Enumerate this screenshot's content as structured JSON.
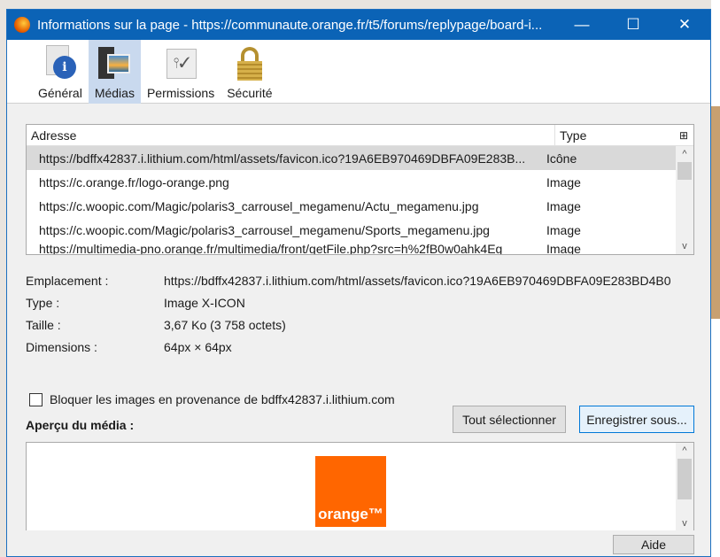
{
  "window": {
    "title": "Informations sur la page - https://communaute.orange.fr/t5/forums/replypage/board-i...",
    "minimize": "—",
    "maximize": "☐",
    "close": "✕"
  },
  "tabs": [
    {
      "label": "Général"
    },
    {
      "label": "Médias"
    },
    {
      "label": "Permissions"
    },
    {
      "label": "Sécurité"
    }
  ],
  "list": {
    "col_address": "Adresse",
    "col_type": "Type",
    "picker": "⊞",
    "rows": [
      {
        "address": "https://bdffx42837.i.lithium.com/html/assets/favicon.ico?19A6EB970469DBFA09E283B...",
        "type": "Icône"
      },
      {
        "address": "https://c.orange.fr/logo-orange.png",
        "type": "Image"
      },
      {
        "address": "https://c.woopic.com/Magic/polaris3_carrousel_megamenu/Actu_megamenu.jpg",
        "type": "Image"
      },
      {
        "address": "https://c.woopic.com/Magic/polaris3_carrousel_megamenu/Sports_megamenu.jpg",
        "type": "Image"
      },
      {
        "address": "https://multimedia-pno.orange.fr/multimedia/front/getFile.php?src=h%2fB0w0ahk4Eg",
        "type": "Image"
      }
    ]
  },
  "details": [
    {
      "key": "Emplacement :",
      "value": "https://bdffx42837.i.lithium.com/html/assets/favicon.ico?19A6EB970469DBFA09E283BD4B0"
    },
    {
      "key": "Type :",
      "value": "Image X-ICON"
    },
    {
      "key": "Taille :",
      "value": "3,67 Ko (3 758 octets)"
    },
    {
      "key": "Dimensions :",
      "value": "64px × 64px"
    }
  ],
  "block_images": "Bloquer les images en provenance de bdffx42837.i.lithium.com",
  "preview_label": "Aperçu du média :",
  "select_all": "Tout sélectionner",
  "save_as": "Enregistrer sous...",
  "help": "Aide",
  "preview_logo": "orange™"
}
